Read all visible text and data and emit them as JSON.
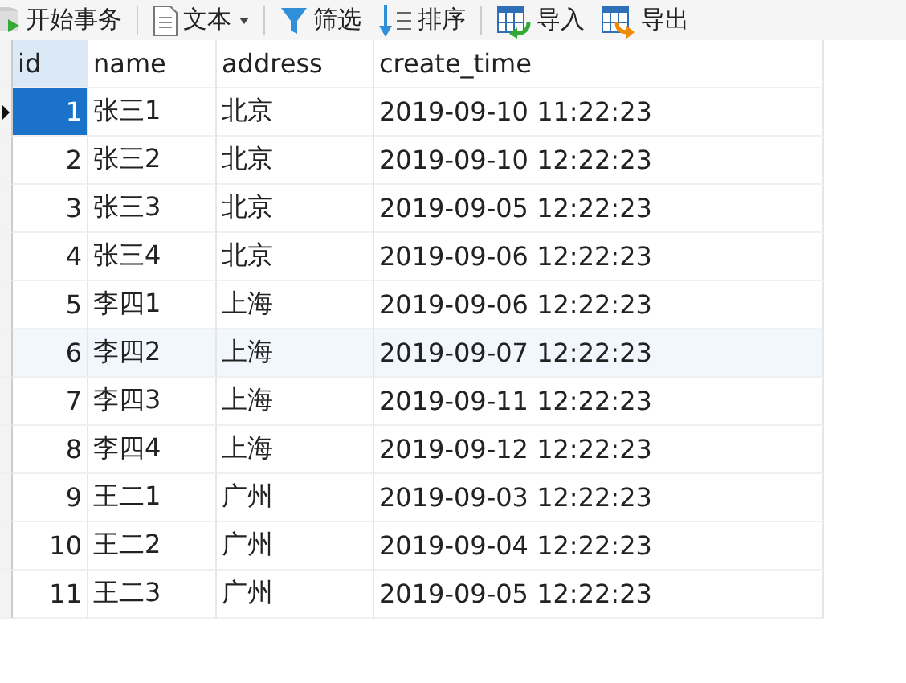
{
  "toolbar": [
    {
      "label": "开始事务",
      "kind": "begin",
      "dropdown": false
    },
    {
      "label": "文本",
      "kind": "text",
      "dropdown": true
    },
    {
      "label": "筛选",
      "kind": "filter",
      "dropdown": false
    },
    {
      "label": "排序",
      "kind": "sort",
      "dropdown": false
    },
    {
      "label": "导入",
      "kind": "import",
      "dropdown": false
    },
    {
      "label": "导出",
      "kind": "export",
      "dropdown": false
    }
  ],
  "table": {
    "columns": [
      "id",
      "name",
      "address",
      "create_time"
    ],
    "rows": [
      {
        "cells": [
          "1",
          "张三1",
          "北京",
          "2019-09-10 11:22:23"
        ],
        "selected": true,
        "highlighted": false
      },
      {
        "cells": [
          "2",
          "张三2",
          "北京",
          "2019-09-10 12:22:23"
        ],
        "selected": false,
        "highlighted": false
      },
      {
        "cells": [
          "3",
          "张三3",
          "北京",
          "2019-09-05 12:22:23"
        ],
        "selected": false,
        "highlighted": false
      },
      {
        "cells": [
          "4",
          "张三4",
          "北京",
          "2019-09-06 12:22:23"
        ],
        "selected": false,
        "highlighted": false
      },
      {
        "cells": [
          "5",
          "李四1",
          "上海",
          "2019-09-06 12:22:23"
        ],
        "selected": false,
        "highlighted": false
      },
      {
        "cells": [
          "6",
          "李四2",
          "上海",
          "2019-09-07 12:22:23"
        ],
        "selected": false,
        "highlighted": true
      },
      {
        "cells": [
          "7",
          "李四3",
          "上海",
          "2019-09-11 12:22:23"
        ],
        "selected": false,
        "highlighted": false
      },
      {
        "cells": [
          "8",
          "李四4",
          "上海",
          "2019-09-12 12:22:23"
        ],
        "selected": false,
        "highlighted": false
      },
      {
        "cells": [
          "9",
          "王二1",
          "广州",
          "2019-09-03 12:22:23"
        ],
        "selected": false,
        "highlighted": false
      },
      {
        "cells": [
          "10",
          "王二2",
          "广州",
          "2019-09-04 12:22:23"
        ],
        "selected": false,
        "highlighted": false
      },
      {
        "cells": [
          "11",
          "王二3",
          "广州",
          "2019-09-05 12:22:23"
        ],
        "selected": false,
        "highlighted": false
      }
    ]
  }
}
